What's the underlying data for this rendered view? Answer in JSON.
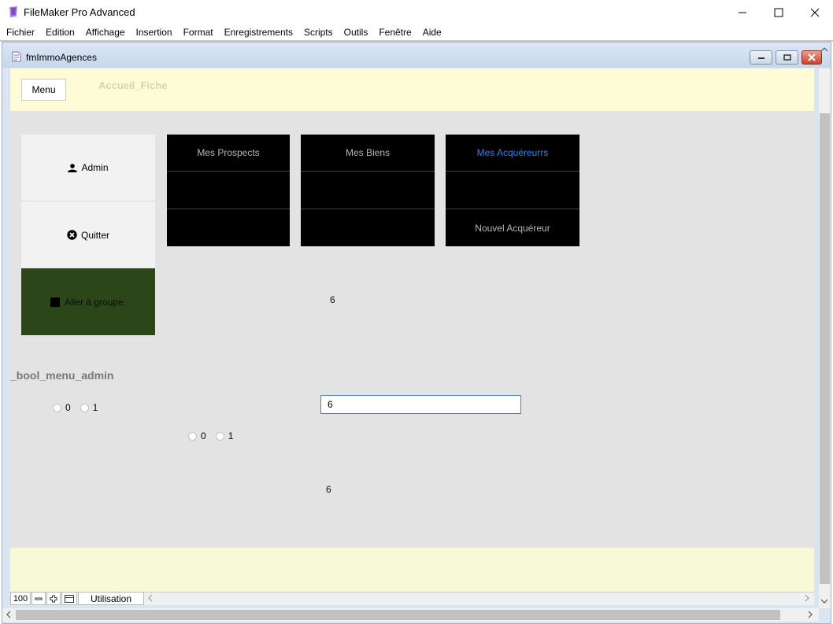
{
  "app": {
    "title": "FileMaker Pro Advanced",
    "menus": [
      "Fichier",
      "Edition",
      "Affichage",
      "Insertion",
      "Format",
      "Enregistrements",
      "Scripts",
      "Outils",
      "Fenêtre",
      "Aide"
    ]
  },
  "document": {
    "title": "fmImmoAgences"
  },
  "header": {
    "menu_button": "Menu",
    "layout_name": "Accueil_Fiche"
  },
  "side_buttons": {
    "admin": "Admin",
    "quitter": "Quitter",
    "aller_groupe": "Aller à groupe."
  },
  "tiles": [
    {
      "row1": "Mes Prospects",
      "row2": "",
      "row3": ""
    },
    {
      "row1": "Mes Biens",
      "row2": "",
      "row3": ""
    },
    {
      "row1": "Mes Acquéreurrs",
      "row2": "",
      "row3": "Nouvel Acquéreur"
    }
  ],
  "fields": {
    "count_top": "6",
    "bool_label": "_bool_menu_admin",
    "radio_a": [
      "0",
      "1"
    ],
    "radio_b": [
      "0",
      "1"
    ],
    "num_field_value": "6",
    "count_bottom": "6"
  },
  "status_bar": {
    "zoom": "100",
    "mode": "Utilisation"
  },
  "colors": {
    "tile_bg": "#000000",
    "tile_highlight_text": "#3d7fe0",
    "go_group_bg": "#2b4719",
    "header_band": "#fefcd6"
  }
}
